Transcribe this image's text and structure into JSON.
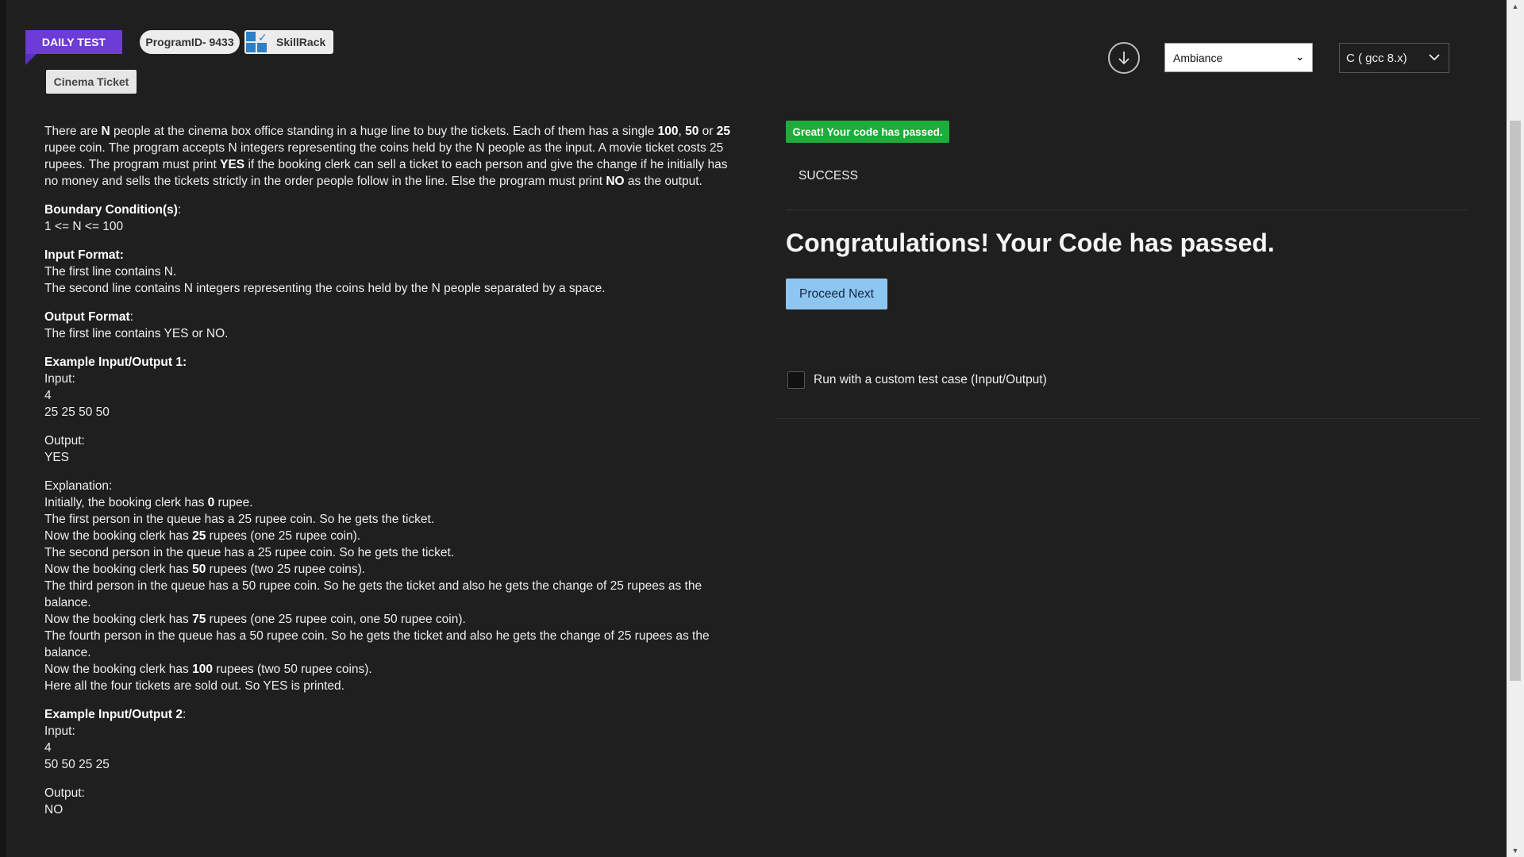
{
  "header": {
    "daily_test_label": "DAILY TEST",
    "program_id_label": "ProgramID- 9433",
    "skillrack_label": "SkillRack",
    "problem_title": "Cinema Ticket"
  },
  "toolbar": {
    "theme_value": "Ambiance",
    "language_value": "C ( gcc 8.x)"
  },
  "problem": {
    "intro": [
      {
        "text": "There are ",
        "bold": false
      },
      {
        "text": "N",
        "bold": true
      },
      {
        "text": " people at the cinema box office standing in a huge line to buy the tickets. Each of them has a single ",
        "bold": false
      },
      {
        "text": "100",
        "bold": true
      },
      {
        "text": ", ",
        "bold": false
      },
      {
        "text": "50",
        "bold": true
      },
      {
        "text": " or ",
        "bold": false
      },
      {
        "text": "25",
        "bold": true
      },
      {
        "text": " rupee coin. The program accepts N integers representing the coins held by the N people as the input. A movie ticket costs 25 rupees. The program must print ",
        "bold": false
      },
      {
        "text": "YES",
        "bold": true
      },
      {
        "text": " if the booking clerk can sell a ticket to each person and give the change if he initially has no money and sells the tickets strictly in the order people follow in the line. Else the program must print ",
        "bold": false
      },
      {
        "text": "NO",
        "bold": true
      },
      {
        "text": " as the output.",
        "bold": false
      }
    ],
    "boundary_heading": "Boundary Condition(s)",
    "boundary_line": "1 <= N <= 100",
    "input_format_heading": "Input Format:",
    "input_format_lines": [
      "The first line contains N.",
      "The second line contains N integers representing the coins held by the N people separated by a space."
    ],
    "output_format_heading": "Output Format",
    "output_format_line": "The first line contains YES or NO.",
    "example1_heading": "Example Input/Output 1:",
    "example1_input_label": "Input:",
    "example1_input_lines": [
      "4",
      "25 25 50 50"
    ],
    "example1_output_label": "Output:",
    "example1_output_value": "YES",
    "explanation_label": "Explanation:",
    "explanation_lines": [
      [
        {
          "text": "Initially, the booking clerk has ",
          "bold": false
        },
        {
          "text": "0",
          "bold": true
        },
        {
          "text": " rupee.",
          "bold": false
        }
      ],
      [
        {
          "text": "The first person in the queue has a 25 rupee coin. So he gets the ticket.",
          "bold": false
        }
      ],
      [
        {
          "text": "Now the booking clerk has ",
          "bold": false
        },
        {
          "text": "25",
          "bold": true
        },
        {
          "text": " rupees (one 25 rupee coin).",
          "bold": false
        }
      ],
      [
        {
          "text": "The second person in the queue has a 25 rupee coin. So he gets the ticket.",
          "bold": false
        }
      ],
      [
        {
          "text": "Now the booking clerk has ",
          "bold": false
        },
        {
          "text": "50",
          "bold": true
        },
        {
          "text": " rupees (two 25 rupee coins).",
          "bold": false
        }
      ],
      [
        {
          "text": "The third person in the queue has a 50 rupee coin. So he gets the ticket and also he gets the change of 25 rupees as the balance.",
          "bold": false
        }
      ],
      [
        {
          "text": "Now the booking clerk has ",
          "bold": false
        },
        {
          "text": "75",
          "bold": true
        },
        {
          "text": " rupees (one 25 rupee coin, one 50 rupee coin).",
          "bold": false
        }
      ],
      [
        {
          "text": "The fourth person in the queue has a 50 rupee coin. So he gets the ticket and also he gets the change of 25 rupees as the balance.",
          "bold": false
        }
      ],
      [
        {
          "text": "Now the booking clerk has ",
          "bold": false
        },
        {
          "text": "100",
          "bold": true
        },
        {
          "text": " rupees (two 50 rupee coins).",
          "bold": false
        }
      ],
      [
        {
          "text": "Here all the four tickets are sold out. So YES is printed.",
          "bold": false
        }
      ]
    ],
    "example2_heading": "Example Input/Output 2",
    "example2_input_label": "Input:",
    "example2_input_lines": [
      "4",
      "50 50 25 25"
    ],
    "example2_output_label": "Output:",
    "example2_output_value": "NO"
  },
  "result": {
    "badge_text": "Great! Your code has passed.",
    "status_text": "SUCCESS",
    "congrats_text": "Congratulations! Your Code has passed.",
    "proceed_label": "Proceed Next",
    "custom_test_label": "Run with a custom test case (Input/Output)"
  },
  "icons": {
    "download": "download-icon",
    "dropdown": "chevron-down-icon",
    "logo": "skillrack-logo-icon"
  },
  "colors": {
    "background": "#1f1f1f",
    "daily_badge": "#6d3bd6",
    "success_badge": "#1cad3a",
    "proceed_button": "#8ec6f2"
  }
}
